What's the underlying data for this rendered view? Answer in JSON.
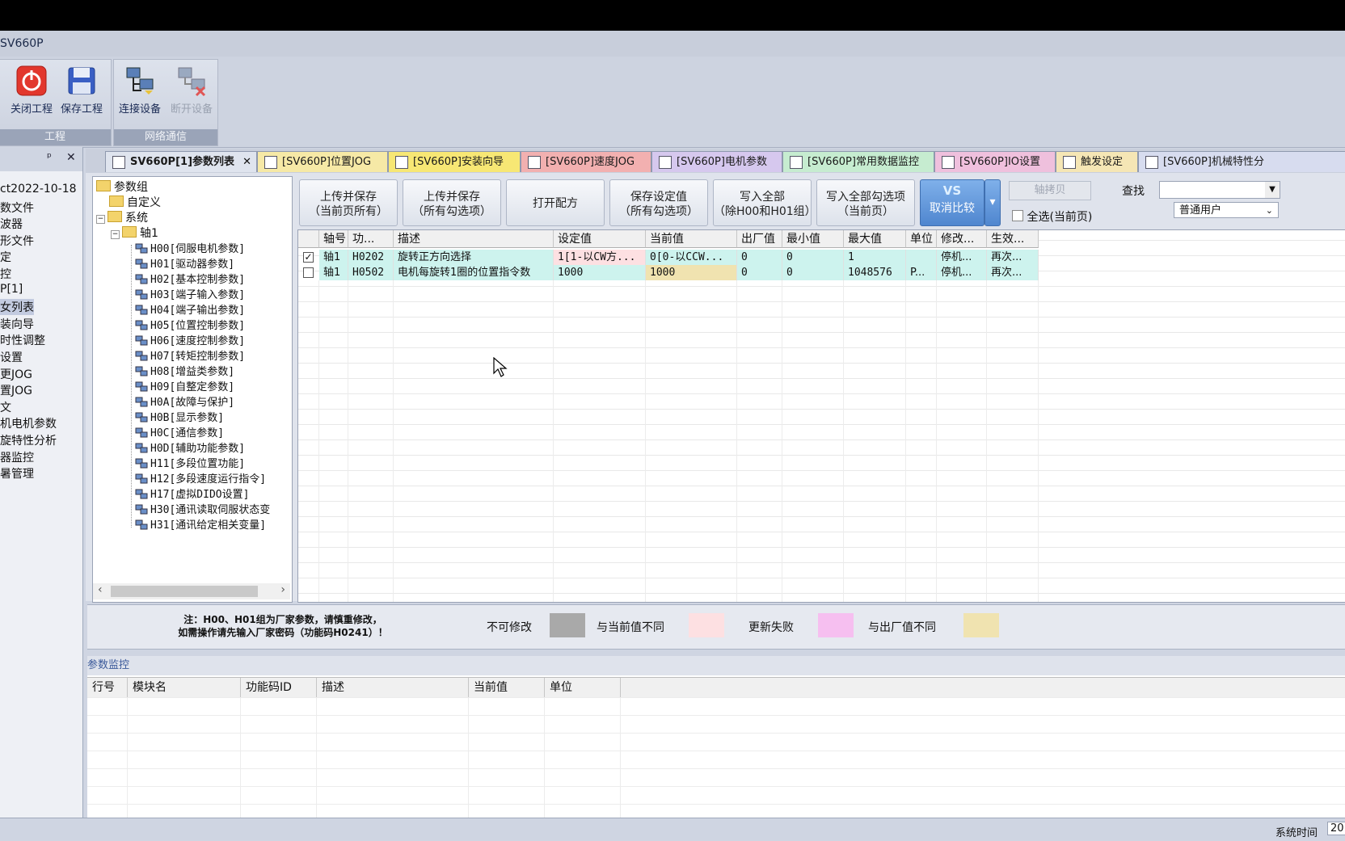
{
  "app": {
    "title": "SV660P"
  },
  "ribbon": {
    "groups": [
      {
        "label": "工程"
      },
      {
        "label": "网络通信"
      }
    ],
    "buttons": {
      "close_project": "关闭工程",
      "save_project": "保存工程",
      "connect": "连接设备",
      "disconnect": "断开设备"
    },
    "colors": {
      "close": "#e2372d",
      "save": "#3a5fc4"
    }
  },
  "left_panel": {
    "items": [
      "ct2022-10-18",
      "数文件",
      "波器",
      "形文件",
      "定",
      "控",
      "P[1]",
      "女列表",
      "装向导",
      "时性调整",
      "设置",
      "更JOG",
      "置JOG",
      "文",
      "机电机参数",
      "旋特性分析",
      "器监控",
      "暑管理"
    ],
    "selected_index": 7
  },
  "tabs": [
    {
      "label": "SV660P[1]参数列表",
      "close": "✕",
      "color": "#dfe4ee"
    },
    {
      "label": "[SV660P]位置JOG",
      "color": "#f6e9a6"
    },
    {
      "label": "[SV660P]安装向导",
      "color": "#f7e774"
    },
    {
      "label": "[SV660P]速度JOG",
      "color": "#f2b0b0"
    },
    {
      "label": "[SV660P]电机参数",
      "color": "#d6c8ee"
    },
    {
      "label": "[SV660P]常用数据监控",
      "color": "#c6ecd0"
    },
    {
      "label": "[SV660P]IO设置",
      "color": "#efc0dd"
    },
    {
      "label": "触发设定",
      "color": "#f5e6b5"
    },
    {
      "label": "[SV660P]机械特性分",
      "color": "#d7dcef"
    }
  ],
  "tree": {
    "root": "参数组",
    "custom": "自定义",
    "system": "系统",
    "axis": "轴1",
    "groups": [
      "H00[伺服电机参数]",
      "H01[驱动器参数]",
      "H02[基本控制参数]",
      "H03[端子输入参数]",
      "H04[端子输出参数]",
      "H05[位置控制参数]",
      "H06[速度控制参数]",
      "H07[转矩控制参数]",
      "H08[增益类参数]",
      "H09[自整定参数]",
      "H0A[故障与保护]",
      "H0B[显示参数]",
      "H0C[通信参数]",
      "H0D[辅助功能参数]",
      "H11[多段位置功能]",
      "H12[多段速度运行指令]",
      "H17[虚拟DIDO设置]",
      "H30[通讯读取伺服状态变",
      "H31[通讯给定相关变量]"
    ]
  },
  "toolbar": {
    "upload_save_page": [
      "上传并保存",
      "（当前页所有）"
    ],
    "upload_save_checked": [
      "上传并保存",
      "（所有勾选项）"
    ],
    "open_recipe": "打开配方",
    "save_setting": [
      "保存设定值",
      "（所有勾选项）"
    ],
    "write_all": [
      "写入全部",
      "（除H00和H01组）"
    ],
    "write_all_checked": [
      "写入全部勾选项",
      "（当前页）"
    ],
    "compare_icon": "VS",
    "compare": "取消比较",
    "axis_copy": "轴拷贝",
    "select_all": "全选(当前页)",
    "search_label": "查找",
    "search_value": "",
    "user_level": "普通用户"
  },
  "grid": {
    "columns": [
      "轴号",
      "功...",
      "描述",
      "设定值",
      "当前值",
      "出厂值",
      "最小值",
      "最大值",
      "单位",
      "修改...",
      "生效..."
    ],
    "rows": [
      {
        "checked": true,
        "check_mark": "✓",
        "axis": "轴1",
        "code": "H0202",
        "desc": "旋转正方向选择",
        "set": "1[1-以CW方...",
        "current": "0[0-以CCW...",
        "factory": "0",
        "min": "0",
        "max": "1",
        "unit": "",
        "modify": "停机...",
        "effect": "再次..."
      },
      {
        "checked": false,
        "check_mark": "",
        "axis": "轴1",
        "code": "H0502",
        "desc": "电机每旋转1圈的位置指令数",
        "set": "1000",
        "current": "1000",
        "factory": "0",
        "min": "0",
        "max": "1048576",
        "unit": "P...",
        "modify": "停机...",
        "effect": "再次..."
      }
    ]
  },
  "legend": {
    "note": [
      "注：H00、H01组为厂家参数，请慎重修改，",
      "如需操作请先输入厂家密码（功能码H0241）！"
    ],
    "items": [
      {
        "label": "不可修改",
        "color": "#a9a9a9"
      },
      {
        "label": "与当前值不同",
        "color": "#fde0e2"
      },
      {
        "label": "更新失败",
        "color": "#f6bff0"
      },
      {
        "label": "与出厂值不同",
        "color": "#f0e3b0"
      }
    ]
  },
  "monitor": {
    "title": "参数监控",
    "columns": [
      "行号",
      "模块名",
      "功能码ID",
      "描述",
      "当前值",
      "单位"
    ]
  },
  "status": {
    "time_label": "系统时间",
    "time_value": "20"
  }
}
